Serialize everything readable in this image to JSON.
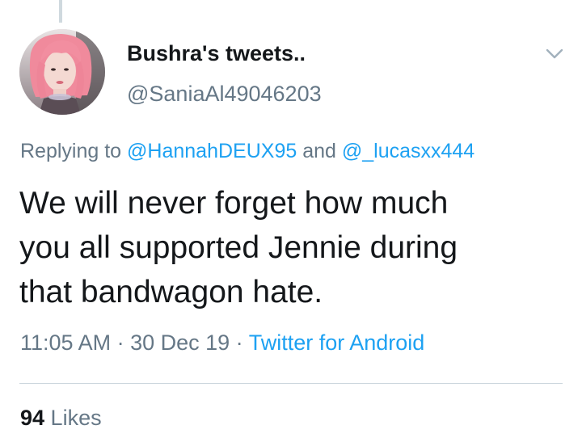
{
  "tweet": {
    "display_name": "Bushra's tweets..",
    "handle": "@SaniaAl49046203",
    "avatar_icon": "profile-photo",
    "menu_icon": "chevron-down-icon",
    "reply": {
      "prefix": "Replying to ",
      "mention_1": "@HannahDEUX95",
      "joiner": " and ",
      "mention_2": "@_lucasxx444"
    },
    "text": "We will never forget how much\nyou all supported Jennie during\nthat bandwagon hate.",
    "time": "11:05 AM",
    "separator_1": " · ",
    "date": "30 Dec 19",
    "separator_2": " · ",
    "source": "Twitter for Android",
    "likes": {
      "count": "94",
      "label": " Likes"
    }
  },
  "colors": {
    "text_primary": "#14171a",
    "text_secondary": "#657786",
    "accent": "#1da1f2",
    "divider": "#ccd6dd",
    "avatar_hair": "#f0899a"
  }
}
